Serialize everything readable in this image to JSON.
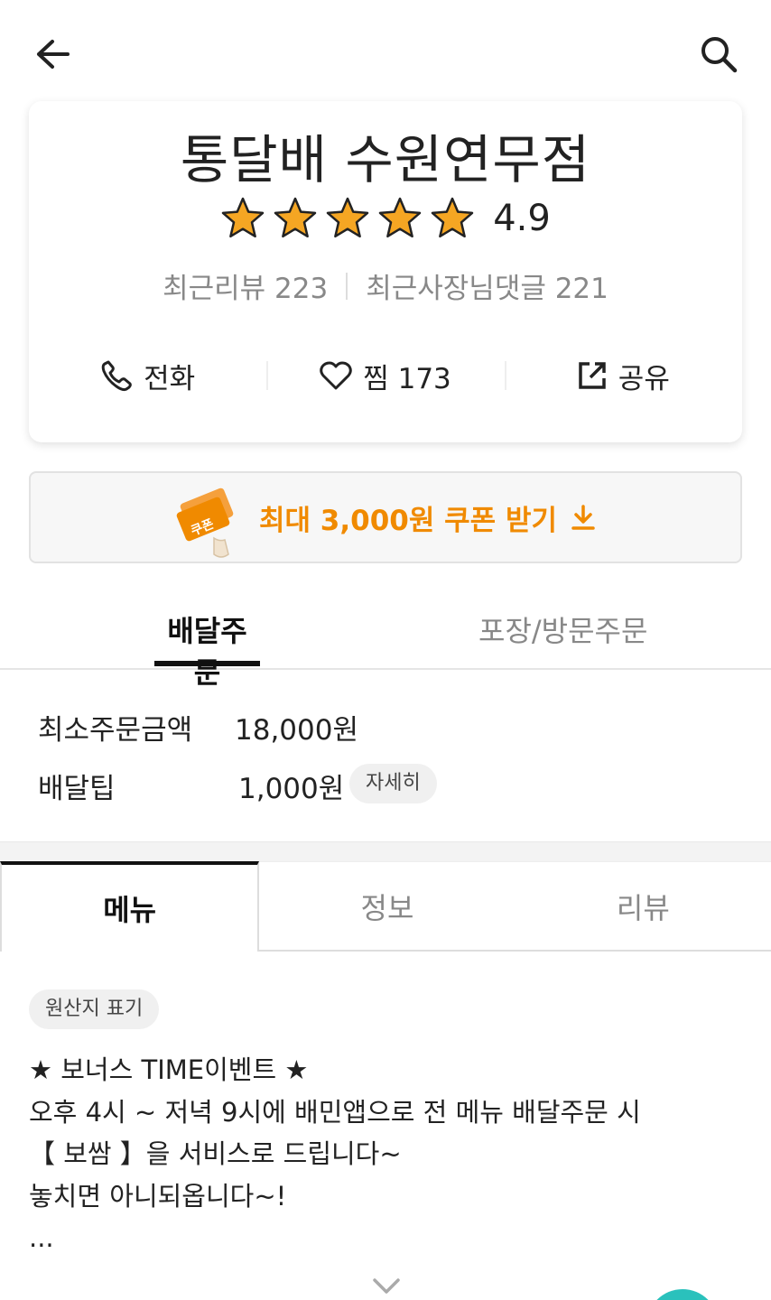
{
  "header": {
    "back_icon": "arrow-left-icon",
    "search_icon": "search-icon"
  },
  "store": {
    "name": "통달배 수원연무점",
    "rating": "4.9",
    "stars": 5,
    "star_color": "#f5a623",
    "recent_reviews": "최근리뷰 223",
    "recent_owner_replies": "최근사장님댓글 221",
    "actions": {
      "call_label": "전화",
      "like_label": "찜",
      "like_count": "173",
      "share_label": "공유"
    }
  },
  "coupon": {
    "label": "최대 3,000원 쿠폰 받기",
    "ticket_text": "쿠폰",
    "accent": "#f08a00"
  },
  "order_tabs": {
    "delivery": "배달주문",
    "pickup": "포장/방문주문"
  },
  "delivery_info": {
    "min_order_label": "최소주문금액",
    "min_order_value": "18,000원",
    "tip_label": "배달팁",
    "tip_value": "1,000원",
    "detail_button": "자세히"
  },
  "menu_tabs": {
    "menu": "메뉴",
    "info": "정보",
    "review": "리뷰"
  },
  "origin_chip": "원산지 표기",
  "notice": {
    "line1": "★ 보너스 TIME이벤트 ★",
    "line2": "오후 4시 ~ 저녁 9시에 배민앱으로 전 메뉴 배달주문 시",
    "line3": "【 보쌈 】을 서비스로 드립니다~",
    "line4": "놓치면 아니되옵니다~!",
    "line5": "..."
  },
  "colors": {
    "fab": "#2ac1bc"
  }
}
